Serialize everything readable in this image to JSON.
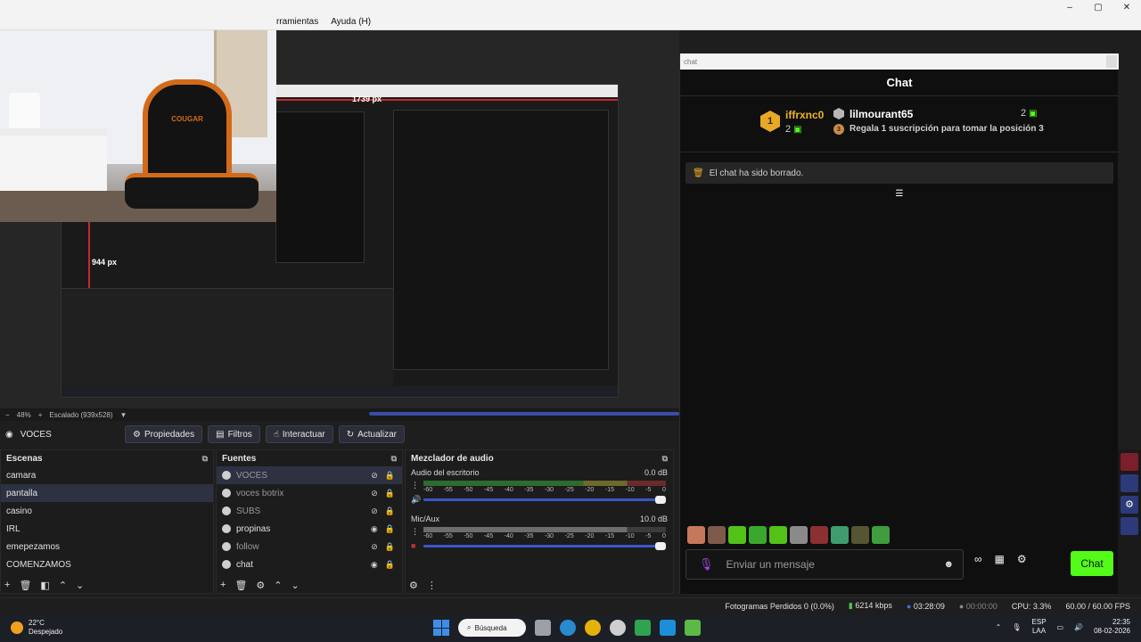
{
  "menubar": {
    "items": [
      "rramientas",
      "Ayuda (H)"
    ]
  },
  "window_controls": [
    "–",
    "▢",
    "✕"
  ],
  "preview": {
    "dim_width": "1739 px",
    "dim_height": "944 px",
    "webcam_logo": "COUGAR",
    "zoom": "48%",
    "scale": "Escalado (939x528)"
  },
  "toolbar": {
    "scene_name": "VOCES",
    "properties": "Propiedades",
    "filters": "Filtros",
    "interact": "Interactuar",
    "refresh": "Actualizar"
  },
  "scenes": {
    "title": "Escenas",
    "items": [
      "camara",
      "pantalla",
      "casino",
      "IRL",
      "emepezamos",
      "COMENZAMOS"
    ],
    "selected": "pantalla"
  },
  "sources": {
    "title": "Fuentes",
    "items": [
      {
        "label": "VOCES",
        "visible": false
      },
      {
        "label": "voces botrix",
        "visible": false
      },
      {
        "label": "SUBS",
        "visible": false
      },
      {
        "label": "propinas",
        "visible": true
      },
      {
        "label": "follow",
        "visible": false
      },
      {
        "label": "chat",
        "visible": true
      }
    ]
  },
  "mixer": {
    "title": "Mezclador de audio",
    "channels": [
      {
        "name": "Audio del escritorio",
        "db": "0.0 dB"
      },
      {
        "name": "Mic/Aux",
        "db": "10.0 dB"
      }
    ],
    "ticks": [
      "-60",
      "-55",
      "-50",
      "-45",
      "-40",
      "-35",
      "-30",
      "-25",
      "-20",
      "-15",
      "-10",
      "-5",
      "0"
    ]
  },
  "chat": {
    "window_title": "chat",
    "header": "Chat",
    "leaderboard": {
      "first": {
        "rank": "1",
        "user": "iffrxnc0",
        "count": "2"
      },
      "second": {
        "user": "lilmourant65",
        "count": "2"
      },
      "third": {
        "rank": "3",
        "text": "Regala 1 suscripción para tomar la posición 3"
      }
    },
    "system_message": "El chat ha sido borrado.",
    "input_placeholder": "Enviar un mensaje",
    "send_label": "Chat",
    "brand_color": "#53fc18",
    "emote_colors": [
      "#c6795a",
      "#7d5a4a",
      "#53c218",
      "#3aa82c",
      "#53c218",
      "#8a8a8a",
      "#8b3030",
      "#3f9c6e",
      "#555533",
      "#3f9c3f"
    ]
  },
  "status": {
    "dropped": "Fotogramas Perdidos 0 (0.0%)",
    "bitrate": "6214 kbps",
    "stream_time": "03:28:09",
    "rec_time": "00:00:00",
    "cpu": "CPU: 3.3%",
    "fps": "60.00 / 60.00 FPS"
  },
  "taskbar": {
    "temp": "22°C",
    "weather": "Despejado",
    "search": "Búsqueda",
    "lang_top": "ESP",
    "lang_bottom": "LAA",
    "time": "22:35",
    "date": "08-02-2026",
    "app_colors": [
      "#9aa0a6",
      "#2a8ad0",
      "#e5b20b",
      "#cfcfcf",
      "#2ea44f",
      "#1b8fd8",
      "#5cb947"
    ]
  }
}
